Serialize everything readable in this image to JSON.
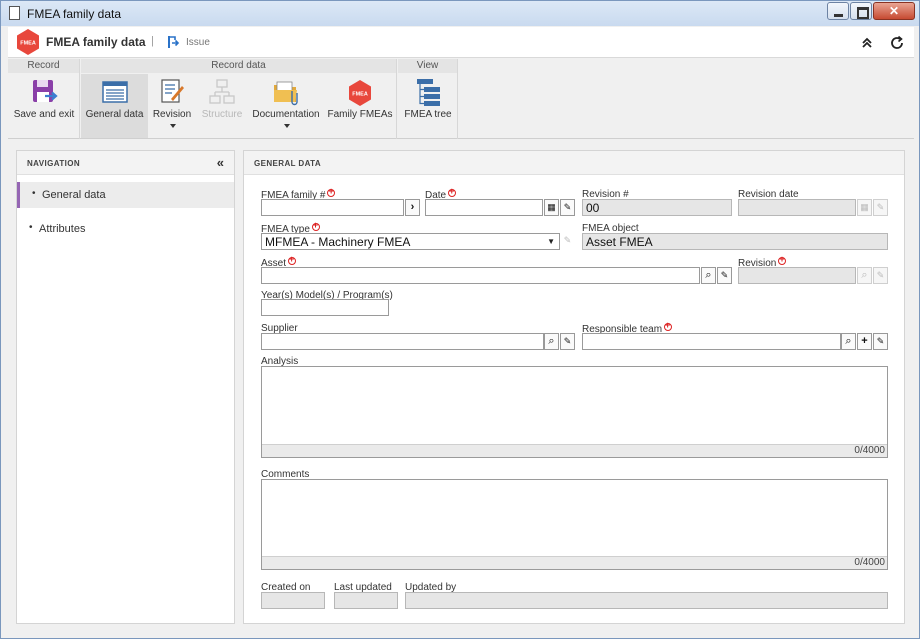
{
  "window": {
    "title": "FMEA family data"
  },
  "header": {
    "title": "FMEA family data",
    "separator": "|",
    "issue_label": "Issue"
  },
  "ribbon": {
    "groups": {
      "record": "Record",
      "record_data": "Record data",
      "view": "View"
    },
    "buttons": {
      "save_exit": "Save and exit",
      "general_data": "General data",
      "revision": "Revision",
      "structure": "Structure",
      "documentation": "Documentation",
      "family_fmeas": "Family FMEAs",
      "fmea_tree": "FMEA tree"
    }
  },
  "navigation": {
    "title": "NAVIGATION",
    "items": [
      {
        "label": "General data"
      },
      {
        "label": "Attributes"
      }
    ]
  },
  "form": {
    "section_title": "GENERAL DATA",
    "fields": {
      "fmea_family_no": {
        "label": "FMEA family #",
        "value": ""
      },
      "date": {
        "label": "Date",
        "value": ""
      },
      "revision_no": {
        "label": "Revision #",
        "value": "00"
      },
      "revision_date": {
        "label": "Revision date",
        "value": ""
      },
      "fmea_type": {
        "label": "FMEA type",
        "value": "MFMEA - Machinery FMEA"
      },
      "fmea_object": {
        "label": "FMEA object",
        "value": "Asset FMEA"
      },
      "asset": {
        "label": "Asset",
        "value": ""
      },
      "revision": {
        "label": "Revision",
        "value": ""
      },
      "years_models": {
        "label": "Year(s) Model(s) / Program(s)",
        "value": ""
      },
      "supplier": {
        "label": "Supplier",
        "value": ""
      },
      "responsible_team": {
        "label": "Responsible team",
        "value": ""
      },
      "analysis": {
        "label": "Analysis",
        "counter": "0/4000"
      },
      "comments": {
        "label": "Comments",
        "counter": "0/4000"
      },
      "created_on": {
        "label": "Created on",
        "value": ""
      },
      "last_updated": {
        "label": "Last updated",
        "value": ""
      },
      "updated_by": {
        "label": "Updated by",
        "value": ""
      }
    }
  },
  "colors": {
    "accent_purple": "#9566b4",
    "logo_red": "#e8473c",
    "required_red": "#dd2222",
    "title_bar": "#c9daef"
  }
}
